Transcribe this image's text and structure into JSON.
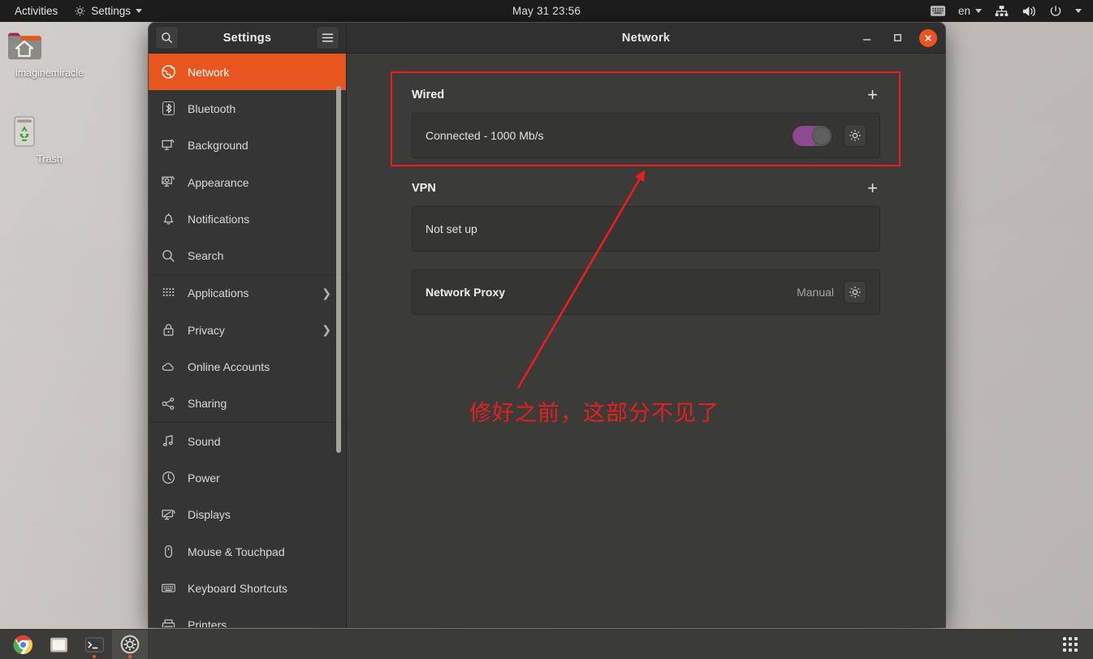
{
  "topbar": {
    "activities_label": "Activities",
    "app_menu_label": "Settings",
    "app_menu_icon": "gear-icon",
    "clock": "May 31  23:56",
    "keyboard_icon": "keyboard-icon",
    "language_label": "en",
    "network_icon": "wired-network-icon",
    "volume_icon": "volume-icon",
    "power_icon": "power-icon",
    "menu_caret_icon": "chevron-down-icon"
  },
  "desktop": {
    "icons": [
      {
        "name": "imaginemiracle",
        "icon": "home-folder-icon"
      },
      {
        "name": "Trash",
        "icon": "trash-icon"
      }
    ]
  },
  "window": {
    "sidebar_title": "Settings",
    "title": "Network",
    "search_icon": "search-icon",
    "menu_icon": "hamburger-menu-icon",
    "minimize_icon": "minimize-icon",
    "maximize_icon": "maximize-icon",
    "close_icon": "close-icon",
    "accent_color": "#e8561f"
  },
  "sidebar": {
    "items": [
      {
        "label": "Network",
        "icon": "globe-icon",
        "active": true,
        "chevron": false
      },
      {
        "label": "Bluetooth",
        "icon": "bluetooth-icon",
        "active": false,
        "chevron": false
      },
      {
        "label": "Background",
        "icon": "monitor-icon",
        "active": false,
        "chevron": false
      },
      {
        "label": "Appearance",
        "icon": "appearance-icon",
        "active": false,
        "chevron": false
      },
      {
        "label": "Notifications",
        "icon": "bell-icon",
        "active": false,
        "chevron": false
      },
      {
        "label": "Search",
        "icon": "search-icon",
        "active": false,
        "chevron": false
      },
      {
        "label": "Applications",
        "icon": "apps-grid-icon",
        "active": false,
        "chevron": true
      },
      {
        "label": "Privacy",
        "icon": "lock-icon",
        "active": false,
        "chevron": true
      },
      {
        "label": "Online Accounts",
        "icon": "cloud-icon",
        "active": false,
        "chevron": false
      },
      {
        "label": "Sharing",
        "icon": "share-icon",
        "active": false,
        "chevron": false
      },
      {
        "label": "Sound",
        "icon": "music-note-icon",
        "active": false,
        "chevron": false
      },
      {
        "label": "Power",
        "icon": "power-icon",
        "active": false,
        "chevron": false
      },
      {
        "label": "Displays",
        "icon": "display-icon",
        "active": false,
        "chevron": false
      },
      {
        "label": "Mouse & Touchpad",
        "icon": "mouse-icon",
        "active": false,
        "chevron": false
      },
      {
        "label": "Keyboard Shortcuts",
        "icon": "keyboard-icon",
        "active": false,
        "chevron": false
      },
      {
        "label": "Printers",
        "icon": "printer-icon",
        "active": false,
        "chevron": false
      }
    ],
    "separators_after": [
      5,
      9
    ]
  },
  "main": {
    "wired": {
      "title": "Wired",
      "add_label": "+",
      "status": "Connected - 1000 Mb/s",
      "toggle_state": "on",
      "toggle_color": "#8d4a8e",
      "settings_icon": "gear-icon"
    },
    "vpn": {
      "title": "VPN",
      "add_label": "+",
      "status": "Not set up"
    },
    "proxy": {
      "title": "Network Proxy",
      "value": "Manual",
      "settings_icon": "gear-icon"
    }
  },
  "annotations": {
    "text": "修好之前，这部分不见了",
    "color": "#ee1c1c",
    "rect_label": "highlight-rectangle",
    "arrow_label": "pointer-arrow"
  },
  "dock": {
    "apps": [
      {
        "name": "google-chrome",
        "running": false,
        "active": false
      },
      {
        "name": "files",
        "running": false,
        "active": false
      },
      {
        "name": "terminal",
        "running": true,
        "active": false
      },
      {
        "name": "settings",
        "running": true,
        "active": true
      }
    ],
    "show_apps_label": "Show Applications"
  }
}
